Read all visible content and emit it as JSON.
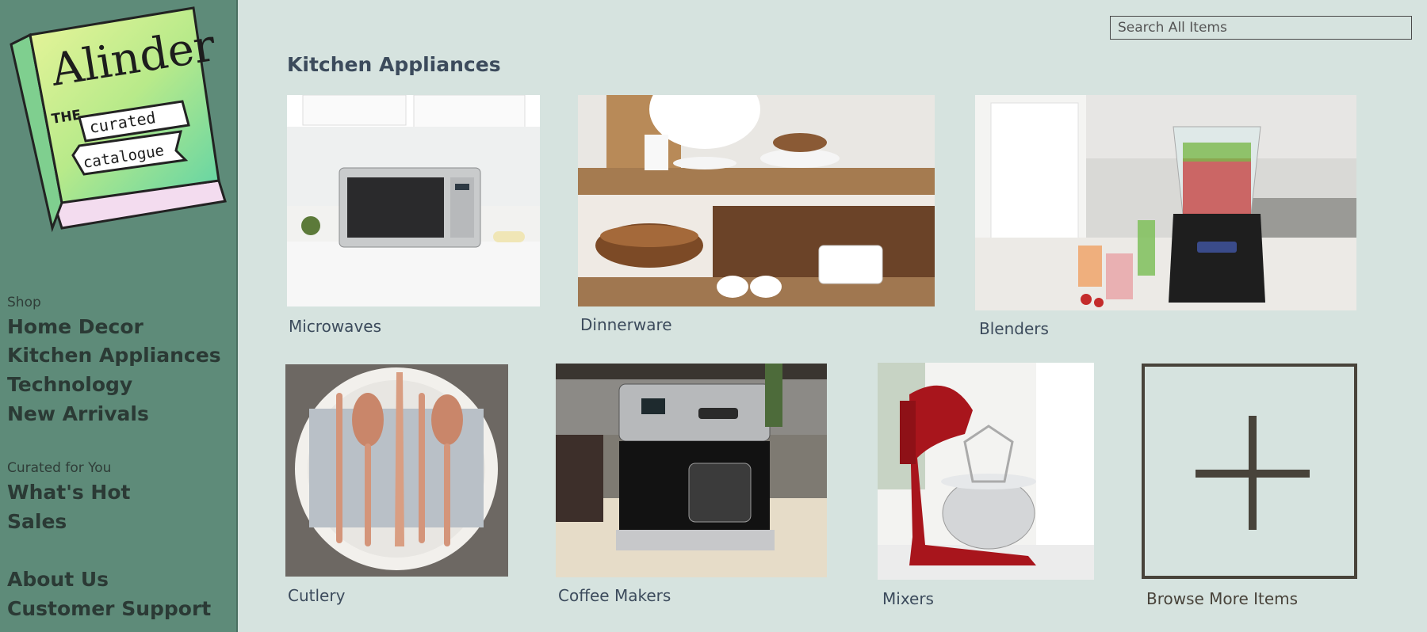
{
  "logo": {
    "title": "Alinder",
    "line_the": "THE",
    "ribbon1": "curated",
    "ribbon2": "catalogue"
  },
  "sidebar": {
    "shop_heading": "Shop",
    "shop_items": [
      "Home Decor",
      "Kitchen Appliances",
      "Technology",
      "New Arrivals"
    ],
    "curated_heading": "Curated for You",
    "curated_items": [
      "What's Hot",
      "Sales"
    ],
    "footer_items": [
      "About Us",
      "Customer Support"
    ]
  },
  "search": {
    "placeholder": "Search All Items"
  },
  "page": {
    "title": "Kitchen Appliances"
  },
  "products": [
    {
      "label": "Microwaves",
      "icon": "microwave-image"
    },
    {
      "label": "Dinnerware",
      "icon": "dinnerware-image"
    },
    {
      "label": "Blenders",
      "icon": "blender-image"
    },
    {
      "label": "Cutlery",
      "icon": "cutlery-image"
    },
    {
      "label": "Coffee Makers",
      "icon": "coffee-maker-image"
    },
    {
      "label": "Mixers",
      "icon": "mixer-image"
    }
  ],
  "browse_more": {
    "label": "Browse More Items",
    "icon": "plus-icon"
  },
  "colors": {
    "sidebar": "#5e8b79",
    "background": "#d6e3df",
    "heading": "#3c4b5c",
    "accent_dark": "#48433a"
  }
}
